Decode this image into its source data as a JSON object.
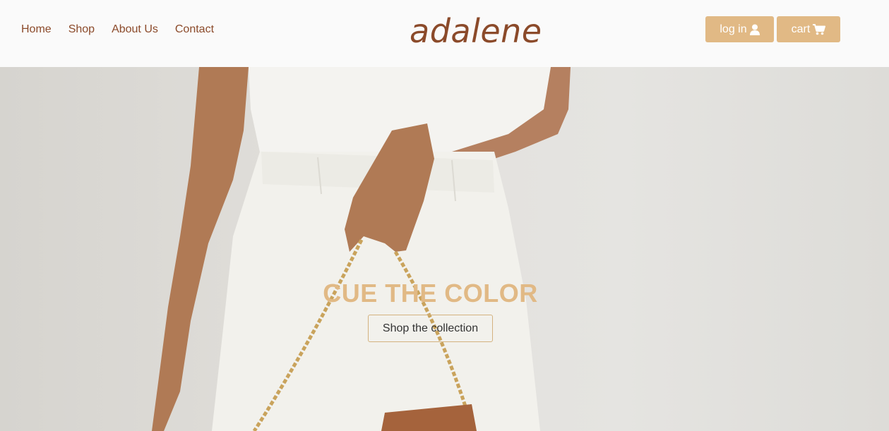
{
  "nav": {
    "items": [
      {
        "label": "Home"
      },
      {
        "label": "Shop"
      },
      {
        "label": "About Us"
      },
      {
        "label": "Contact"
      }
    ]
  },
  "brand": {
    "logo_text": "adalene"
  },
  "actions": {
    "login_label": "log in",
    "login_icon": "user-icon",
    "cart_label": "cart",
    "cart_icon": "shopping-cart-icon"
  },
  "hero": {
    "headline": "CUE THE COLOR",
    "cta_label": "Shop the collection"
  },
  "colors": {
    "brand_brown": "#8b4a2a",
    "accent_tan": "#e1b985",
    "header_bg": "#fafafa"
  }
}
